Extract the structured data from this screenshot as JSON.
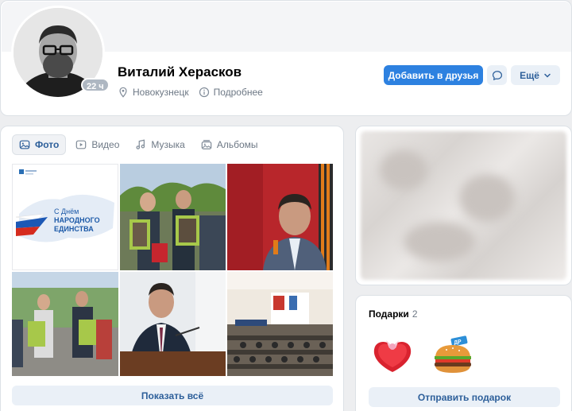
{
  "profile": {
    "name": "Виталий Херасков",
    "online": "22 ч",
    "city": "Новокузнецк",
    "more_info": "Подробнее",
    "add_friend": "Добавить в друзья",
    "more_button": "Ещё"
  },
  "media": {
    "tabs": [
      {
        "label": "Фото",
        "icon": "photo-icon",
        "active": true
      },
      {
        "label": "Видео",
        "icon": "video-icon",
        "active": false
      },
      {
        "label": "Музыка",
        "icon": "music-icon",
        "active": false
      },
      {
        "label": "Альбомы",
        "icon": "albums-icon",
        "active": false
      }
    ],
    "photo1_text": [
      "С Днём",
      "НАРОДНОГО",
      "ЕДИНСТВА"
    ],
    "show_all": "Показать всё"
  },
  "gifts": {
    "title": "Подарки",
    "count": "2",
    "send": "Отправить подарок"
  },
  "colors": {
    "accent": "#2d81e0",
    "link": "#2d5f9a",
    "muted": "#6d7885"
  }
}
